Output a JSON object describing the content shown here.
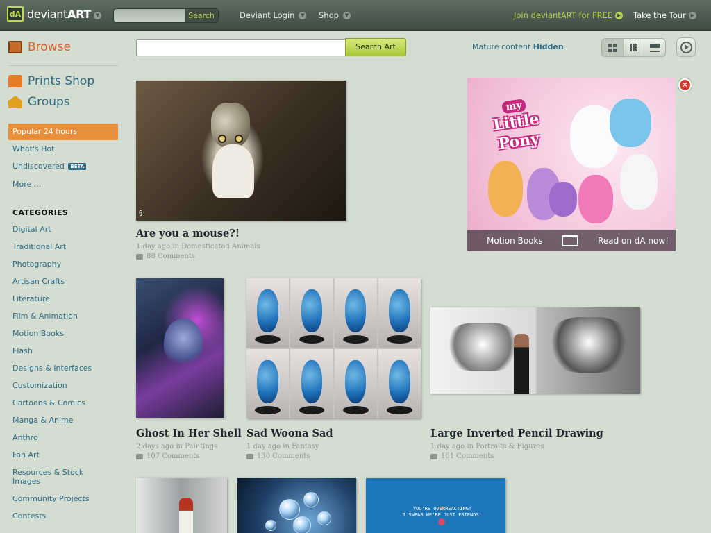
{
  "header": {
    "logo_text_light": "deviant",
    "logo_text_bold": "ART",
    "search_placeholder": "",
    "search_button": "Search",
    "nav": [
      {
        "label": "Deviant Login"
      },
      {
        "label": "Shop"
      }
    ],
    "join_label": "Join deviantART for FREE",
    "tour_label": "Take the Tour"
  },
  "sidebar": {
    "browse": "Browse",
    "prints_shop": "Prints Shop",
    "groups": "Groups",
    "popular": "Popular 24 hours",
    "whats_hot": "What's Hot",
    "undiscovered": "Undiscovered",
    "beta_badge": "BETA",
    "more": "More ...",
    "categories_heading": "CATEGORIES",
    "categories": [
      "Digital Art",
      "Traditional Art",
      "Photography",
      "Artisan Crafts",
      "Literature",
      "Film & Animation",
      "Motion Books",
      "Flash",
      "Designs & Interfaces",
      "Customization",
      "Cartoons & Comics",
      "Manga & Anime",
      "Anthro",
      "Fan Art",
      "Resources & Stock Images",
      "Community Projects",
      "Contests"
    ]
  },
  "toolbar": {
    "search_value": "",
    "search_button": "Search Art",
    "mature_label": "Mature content",
    "mature_state": "Hidden"
  },
  "ad": {
    "logo_my": "my",
    "logo_pony": "Little Pony",
    "left_text": "Motion Books",
    "right_text": "Read on dA now!"
  },
  "deviations": [
    {
      "title": "Are you a mouse?!",
      "age": "1 day ago",
      "in": "in",
      "category": "Domesticated Animals",
      "comments": "88 Comments"
    },
    {
      "title": "Ghost In Her Shell",
      "age": "2 days ago",
      "in": "in",
      "category": "Paintings",
      "comments": "107 Comments"
    },
    {
      "title": "Sad Woona Sad",
      "age": "1 day ago",
      "in": "in",
      "category": "Fantasy",
      "comments": "130 Comments"
    },
    {
      "title": "Large Inverted Pencil Drawing",
      "age": "1 day ago",
      "in": "in",
      "category": "Portraits & Figures",
      "comments": "161 Comments"
    }
  ],
  "thumb_text": {
    "comic_line1": "YOU'RE OVERREACTING!",
    "comic_line2": "I SWEAR WE'RE JUST FRIENDS!"
  }
}
